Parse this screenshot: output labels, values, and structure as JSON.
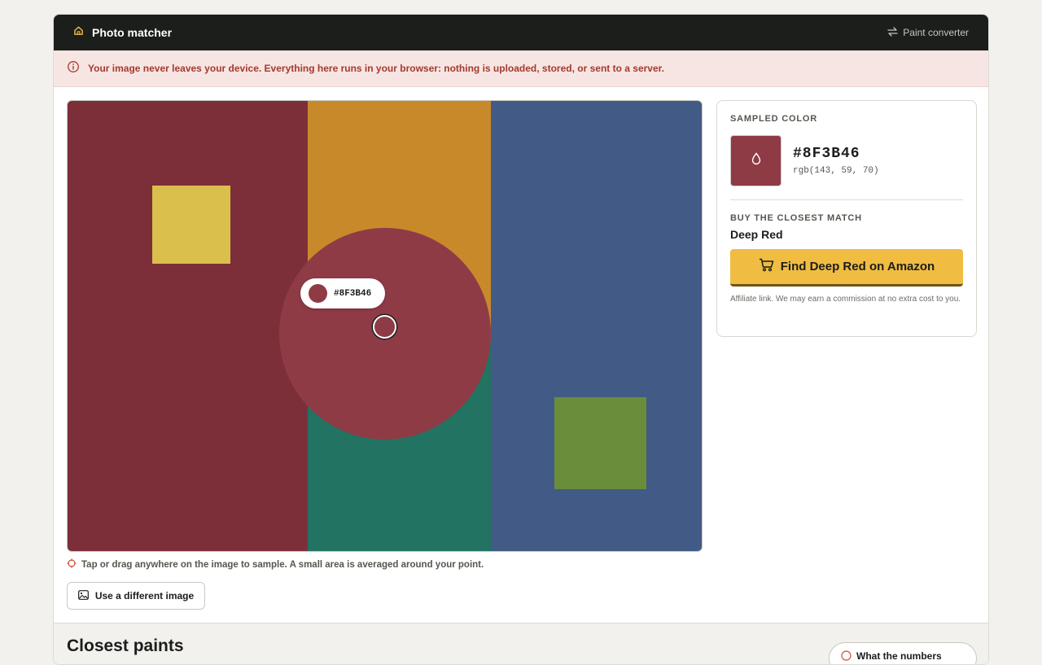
{
  "header": {
    "title": "Photo matcher",
    "nav_link": "Paint converter",
    "home_icon": "home-icon",
    "swap_icon": "swap-icon"
  },
  "notice": {
    "text": "Your image never leaves your device. Everything here runs in your browser: nothing is uploaded, stored, or sent to a server.",
    "icon": "info-icon"
  },
  "image": {
    "blocks_colors": {
      "red": "#7c2f38",
      "orange": "#c8892b",
      "teal": "#227361",
      "blue": "#415b86",
      "yellow": "#dbbf4d",
      "green": "#6a8d3b"
    },
    "loupe_color": "#8f3b46",
    "loupe_label": "#8F3B46"
  },
  "hint": {
    "text": "Tap or drag anywhere on the image to sample. A small area is averaged around your point.",
    "icon": "crosshair-icon"
  },
  "actions": {
    "different_image": "Use a different image",
    "image_icon": "image-icon"
  },
  "sample": {
    "label": "SAMPLED COLOR",
    "hex": "#8F3B46",
    "rgb": "rgb(143, 59, 70)",
    "swatch_color": "#8f3b46",
    "drop_icon": "droplet-icon"
  },
  "match": {
    "label": "BUY THE CLOSEST MATCH",
    "name": "Deep Red",
    "button": "Find Deep Red on Amazon",
    "cart_icon": "cart-icon",
    "fine_print": "Affiliate link. We may earn a commission at no extra cost to you."
  },
  "closest": {
    "title": "Closest paints",
    "pill_text": "What the numbers mean"
  },
  "colors": {
    "accent": "#f0bc42",
    "topbar": "#1c1e1c",
    "notice_bg": "#f7e5e3",
    "notice_text": "#a33a2c"
  }
}
